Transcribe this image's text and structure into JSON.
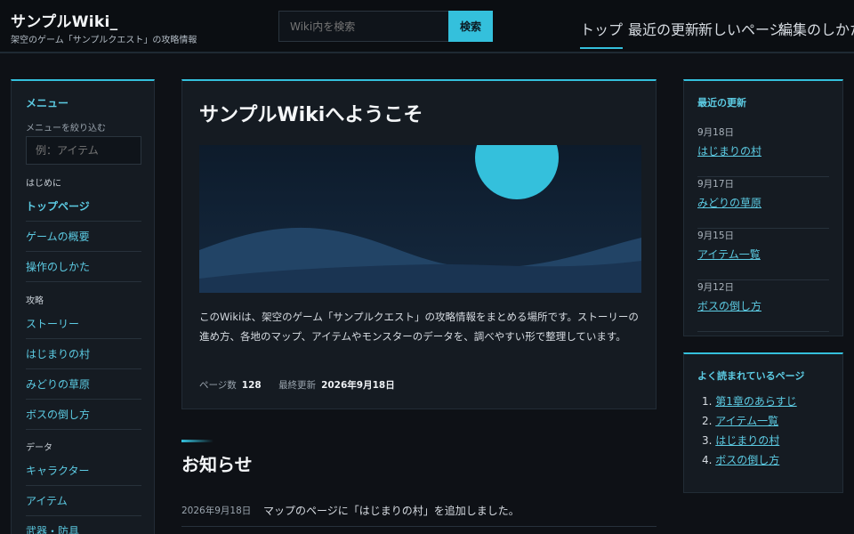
{
  "header": {
    "title": "サンプルWiki_",
    "subtitle": "架空のゲーム「サンプルクエスト」の攻略情報",
    "search_placeholder": "Wiki内を検索",
    "search_button": "検索",
    "nav": [
      "トップ",
      "最近の更新",
      "新しいページ",
      "編集のしかた"
    ]
  },
  "sidebar": {
    "title": "メニュー",
    "filter_label": "メニューを絞り込む",
    "filter_placeholder": "例：アイテム",
    "sections": [
      {
        "label": "はじめに",
        "items": [
          "トップページ",
          "ゲームの概要",
          "操作のしかた"
        ]
      },
      {
        "label": "攻略",
        "items": [
          "ストーリー",
          "はじまりの村",
          "みどりの草原",
          "ボスの倒し方"
        ]
      },
      {
        "label": "データ",
        "items": [
          "キャラクター",
          "アイテム",
          "武器・防具"
        ]
      }
    ]
  },
  "hero": {
    "title": "サンプルWikiへようこそ",
    "text": "このWikiは、架空のゲーム「サンプルクエスト」の攻略情報をまとめる場所です。ストーリーの進め方、各地のマップ、アイテムやモンスターのデータを、調べやすい形で整理しています。",
    "pages_label": "ページ数",
    "pages_value": "128",
    "updated_label": "最終更新",
    "updated_value": "2026年9月18日"
  },
  "news": {
    "title": "お知らせ",
    "items": [
      {
        "date": "2026年9月18日",
        "text": "マップのページに「はじまりの村」を追加しました。"
      }
    ]
  },
  "recent": {
    "title": "最近の更新",
    "items": [
      {
        "date": "9月18日",
        "page": "はじまりの村"
      },
      {
        "date": "9月17日",
        "page": "みどりの草原"
      },
      {
        "date": "9月15日",
        "page": "アイテム一覧"
      },
      {
        "date": "9月12日",
        "page": "ボスの倒し方"
      }
    ]
  },
  "popular": {
    "title": "よく読まれているページ",
    "items": [
      "第1章のあらすじ",
      "アイテム一覧",
      "はじまりの村",
      "ボスの倒し方"
    ]
  },
  "colors": {
    "accent": "#34c0dc",
    "background": "#0e1116",
    "panel": "#151b22"
  }
}
